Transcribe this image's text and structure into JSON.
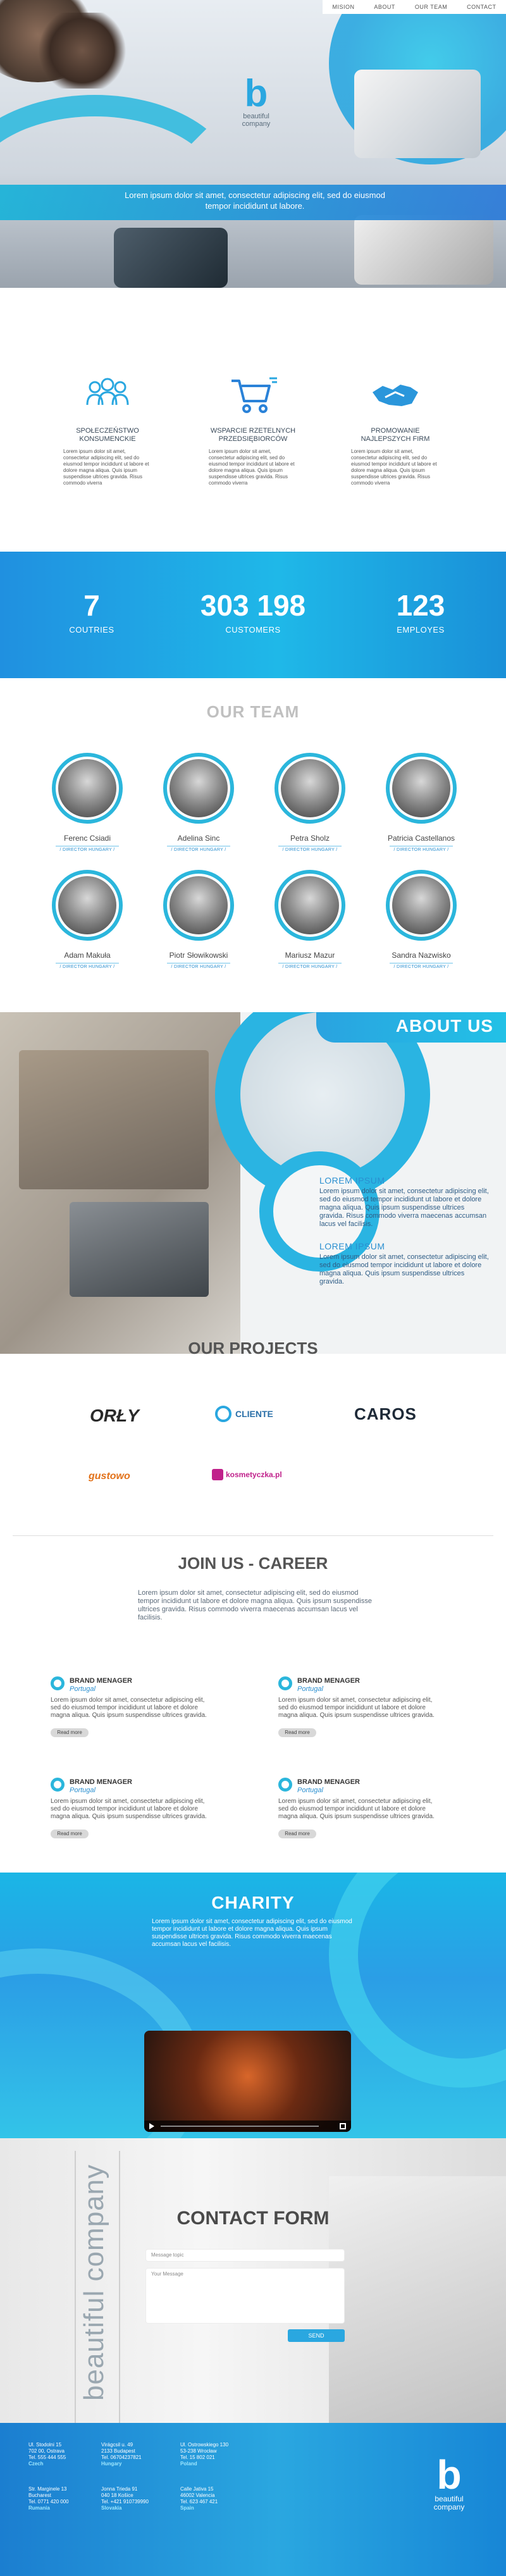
{
  "nav": [
    "MISION",
    "ABOUT",
    "OUR TEAM",
    "CONTACT"
  ],
  "logo": {
    "glyph": "b",
    "line1": "beautiful",
    "line2": "company"
  },
  "hero": {
    "text": "Lorem ipsum dolor sit amet, consectetur adipiscing elit, sed do eiusmod tempor incididunt ut labore."
  },
  "features": [
    {
      "title": "SPOŁECZEŃSTWO KONSUMENCKIE",
      "icon": "people-icon",
      "text": "Lorem ipsum dolor sit amet, consectetur adipiscing elit, sed do eiusmod tempor incididunt ut labore et dolore magna aliqua. Quis ipsum suspendisse ultrices gravida. Risus commodo viverra"
    },
    {
      "title": "WSPARCIE RZETELNYCH PRZEDSIĘBIORCÓW",
      "icon": "cart-icon",
      "text": "Lorem ipsum dolor sit amet, consectetur adipiscing elit, sed do eiusmod tempor incididunt ut labore et dolore magna aliqua. Quis ipsum suspendisse ultrices gravida. Risus commodo viverra"
    },
    {
      "title": "PROMOWANIE NAJLEPSZYCH FIRM",
      "icon": "handshake-icon",
      "text": "Lorem ipsum dolor sit amet, consectetur adipiscing elit, sed do eiusmod tempor incididunt ut labore et dolore magna aliqua. Quis ipsum suspendisse ultrices gravida. Risus commodo viverra"
    }
  ],
  "stats": [
    {
      "number": "7",
      "label": "COUTRIES"
    },
    {
      "number": "303 198",
      "label": "CUSTOMERS"
    },
    {
      "number": "123",
      "label": "EMPLOYES"
    }
  ],
  "team": {
    "title": "OUR TEAM",
    "members": [
      {
        "name": "Ferenc Csiadi",
        "role": "/ DIRECTOR HUNGARY /"
      },
      {
        "name": "Adelina Sinc",
        "role": "/ DIRECTOR HUNGARY /"
      },
      {
        "name": "Petra Sholz",
        "role": "/ DIRECTOR HUNGARY /"
      },
      {
        "name": "Patricia Castellanos",
        "role": "/ DIRECTOR HUNGARY /"
      },
      {
        "name": "Adam Makuła",
        "role": "/ DIRECTOR HUNGARY /"
      },
      {
        "name": "Piotr Słowikowski",
        "role": "/ DIRECTOR HUNGARY /"
      },
      {
        "name": "Mariusz Mazur",
        "role": "/ DIRECTOR HUNGARY /"
      },
      {
        "name": "Sandra Nazwisko",
        "role": "/ DIRECTOR HUNGARY /"
      }
    ]
  },
  "about": {
    "title": "ABOUT US",
    "blocks": [
      {
        "heading": "LOREM IPSUM",
        "text": "Lorem ipsum dolor sit amet, consectetur adipiscing elit, sed do eiusmod tempor incididunt ut labore et dolore magna aliqua. Quis ipsum suspendisse ultrices gravida. Risus commodo viverra maecenas accumsan lacus vel facilisis."
      },
      {
        "heading": "LOREM IPSUM",
        "text": "Lorem ipsum dolor sit amet, consectetur adipiscing elit, sed do eiusmod tempor incididunt ut labore et dolore magna aliqua. Quis ipsum suspendisse ultrices gravida."
      }
    ]
  },
  "projects": {
    "title": "OUR PROJECTS",
    "logos": [
      "ORŁY",
      "CLIENTE",
      "CAROS",
      "gustowo",
      "kosmetyczka.pl"
    ]
  },
  "career": {
    "title": "JOIN US - CAREER",
    "intro": "Lorem ipsum dolor sit amet, consectetur adipiscing elit, sed do eiusmod tempor incididunt ut labore et dolore magna aliqua. Quis ipsum suspendisse ultrices gravida. Risus commodo viverra maecenas accumsan lacus vel facilisis.",
    "jobs": [
      {
        "title": "BRAND MENAGER",
        "location": "Portugal",
        "text": "Lorem ipsum dolor sit amet, consectetur adipiscing elit, sed do eiusmod tempor incididunt ut labore et dolore magna aliqua. Quis ipsum suspendisse ultrices gravida.",
        "button": "Read more"
      },
      {
        "title": "BRAND MENAGER",
        "location": "Portugal",
        "text": "Lorem ipsum dolor sit amet, consectetur adipiscing elit, sed do eiusmod tempor incididunt ut labore et dolore magna aliqua. Quis ipsum suspendisse ultrices gravida.",
        "button": "Read more"
      },
      {
        "title": "BRAND MENAGER",
        "location": "Portugal",
        "text": "Lorem ipsum dolor sit amet, consectetur adipiscing elit, sed do eiusmod tempor incididunt ut labore et dolore magna aliqua. Quis ipsum suspendisse ultrices gravida.",
        "button": "Read more"
      },
      {
        "title": "BRAND MENAGER",
        "location": "Portugal",
        "text": "Lorem ipsum dolor sit amet, consectetur adipiscing elit, sed do eiusmod tempor incididunt ut labore et dolore magna aliqua. Quis ipsum suspendisse ultrices gravida.",
        "button": "Read more"
      }
    ]
  },
  "charity": {
    "title": "CHARITY",
    "text": "Lorem ipsum dolor sit amet, consectetur adipiscing elit, sed do eiusmod tempor incididunt ut labore et dolore magna aliqua. Quis ipsum suspendisse ultrices gravida. Risus commodo viverra maecenas accumsan lacus vel facilisis."
  },
  "contact": {
    "side_text": "beautiful company",
    "title": "CONTACT FORM",
    "topic_placeholder": "Message topic",
    "message_placeholder": "Your Message",
    "send": "SEND"
  },
  "footer": {
    "addresses": [
      {
        "lines": [
          "Ul. Stodolni 15",
          "702 00, Ostrava",
          "Tel. 555 444 555"
        ],
        "country": "Czech"
      },
      {
        "lines": [
          "Virágcsil u. 49",
          "2133 Budapest",
          "Tel. 06704237821"
        ],
        "country": "Hungary"
      },
      {
        "lines": [
          "Ul. Ostrowskiego 130",
          "53-238 Wrocław",
          "Tel. 15 802 021"
        ],
        "country": "Poland"
      },
      {
        "lines": [
          "Str. Marginele 13",
          "Bucharest",
          "Tel. 0771 420 000"
        ],
        "country": "Rumania"
      },
      {
        "lines": [
          "Jonna Trieda 91",
          "040 18 Košice",
          "Tel. +421 910739990"
        ],
        "country": "Slovakia"
      },
      {
        "lines": [
          "Calle Jativa 15",
          "46002 Valencia",
          "Tel. 623 467 421"
        ],
        "country": "Spain"
      }
    ]
  }
}
